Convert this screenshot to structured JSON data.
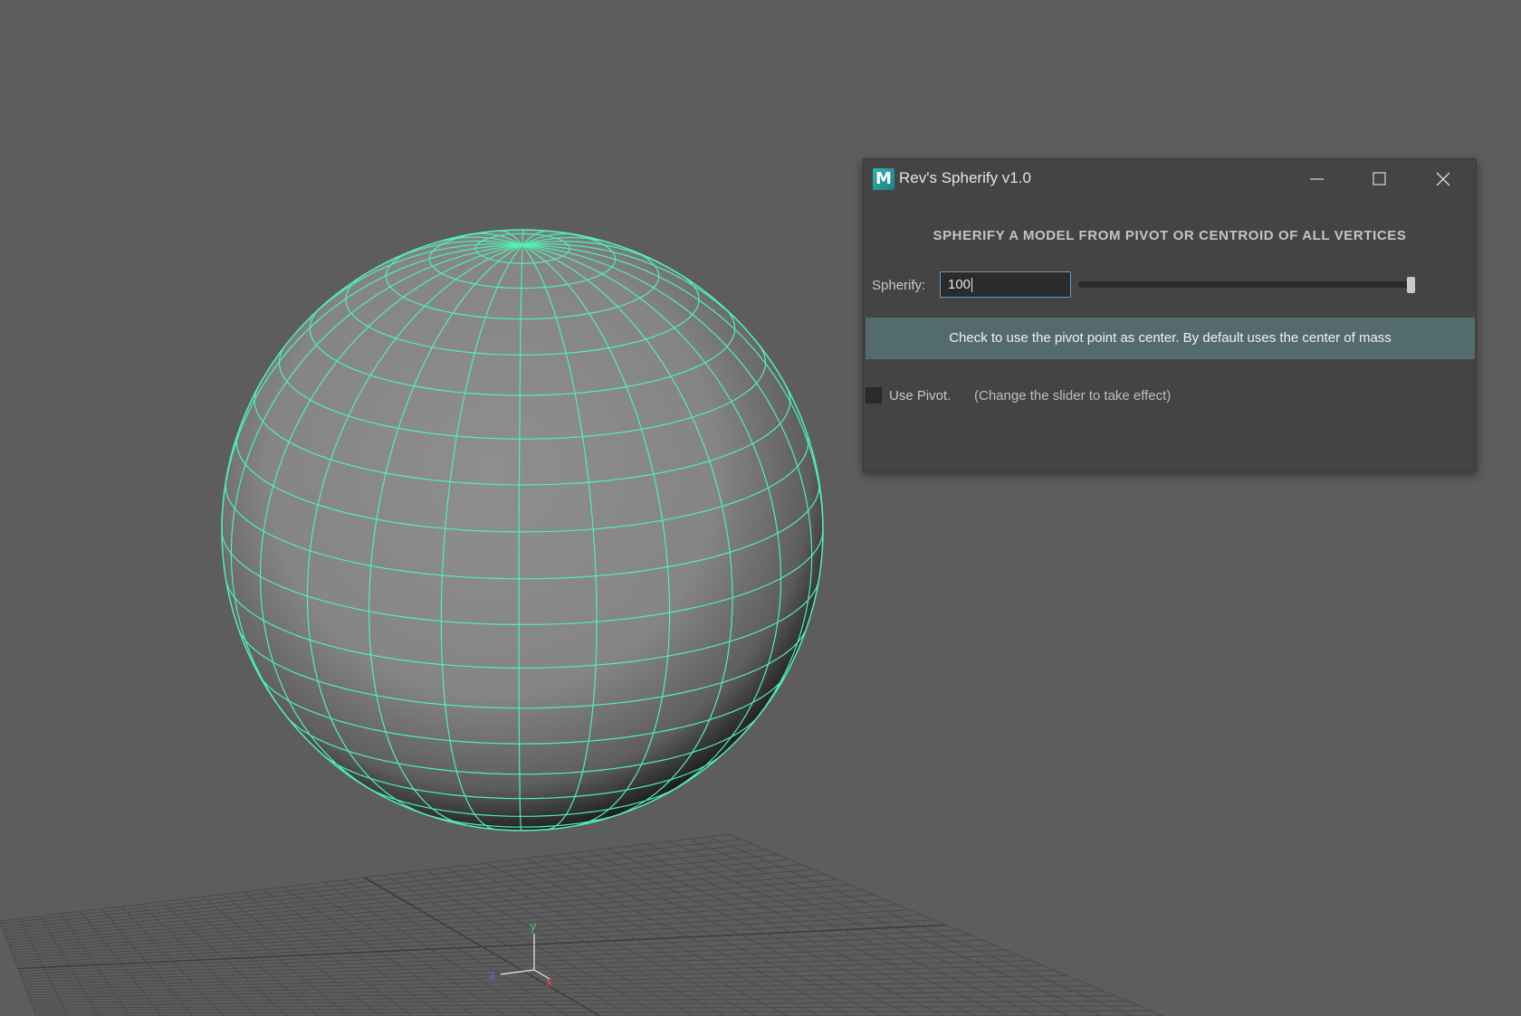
{
  "viewport": {
    "background": "#5d5d5d",
    "wireframe_color": "#4ff0b4",
    "axis": {
      "x_label": "x",
      "y_label": "y",
      "z_label": "z"
    }
  },
  "window": {
    "icon_letter": "M",
    "title": "Rev's Spherify v1.0",
    "heading": "SPHERIFY A MODEL FROM PIVOT OR CENTROID OF ALL VERTICES",
    "spherify_label": "Spherify:",
    "spherify_value": "100",
    "slider_value": 100,
    "slider_max": 100,
    "info_text": "Check to use the pivot point as center. By default uses the center of mass",
    "checkbox_label": "Use Pivot.",
    "hint_text": "(Change the slider to take effect)",
    "use_pivot_checked": false
  }
}
